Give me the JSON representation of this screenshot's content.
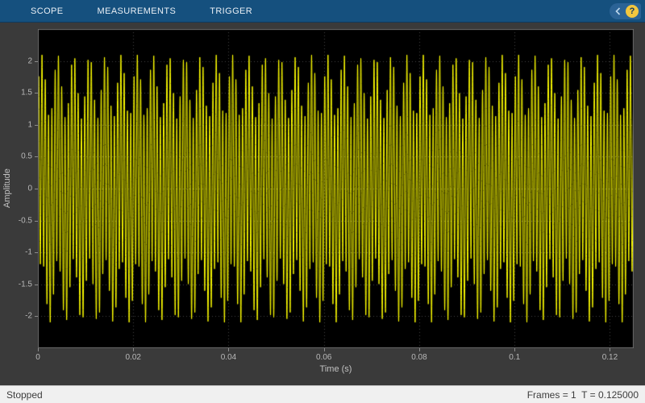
{
  "toolbar": {
    "tabs": [
      {
        "label": "SCOPE"
      },
      {
        "label": "MEASUREMENTS"
      },
      {
        "label": "TRIGGER"
      }
    ],
    "help_label": "?"
  },
  "status_bar": {
    "left": "Stopped",
    "right": "Frames = 1  T = 0.125000"
  },
  "chart_data": {
    "type": "line",
    "title": "",
    "xlabel": "Time (s)",
    "ylabel": "Amplitude",
    "xlim": [
      0,
      0.125
    ],
    "ylim": [
      -2.5,
      2.5
    ],
    "x_ticks": [
      0,
      0.02,
      0.04,
      0.06,
      0.08,
      0.1,
      0.12
    ],
    "x_tick_labels": [
      "0",
      "0.02",
      "0.04",
      "0.06",
      "0.08",
      "0.1",
      "0.12"
    ],
    "y_ticks": [
      2,
      1.5,
      1,
      0.5,
      0,
      -0.5,
      -1,
      -1.5,
      -2
    ],
    "y_tick_labels": [
      "2",
      "1.5",
      "1",
      "0.5",
      "0",
      "-0.5",
      "-1",
      "-1.5",
      "-2"
    ],
    "grid": true,
    "legend": "none",
    "background": "#000000",
    "grid_color": "#454545",
    "axis_box_color": "#6e6e6e",
    "tick_label_color": "#b8b8b8",
    "line_color": "#ffff00",
    "description": "Dense yellow multi-tone sine waveform filling approximately -2.1 to 2.1 with ~38 envelope peaks across 0.125 s",
    "signal": {
      "duration": 0.125,
      "samples": 6000,
      "components": [
        {
          "freq": 1450,
          "amp": 1.6,
          "phase": 0
        },
        {
          "freq": 300,
          "amp": 0.5,
          "phase": 0
        }
      ]
    }
  }
}
